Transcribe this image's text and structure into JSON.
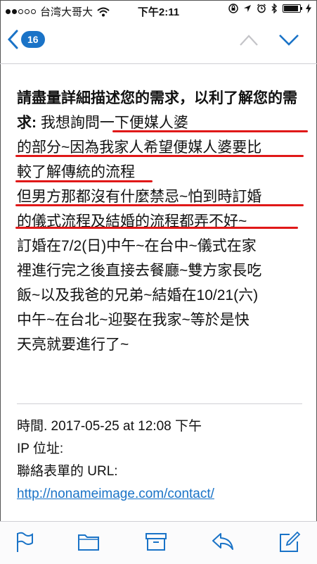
{
  "status": {
    "carrier": "台湾大哥大",
    "time": "下午2:11",
    "battery_level": 0.9
  },
  "nav": {
    "back_count": "16"
  },
  "email": {
    "lead_bold": "請盡量詳細描述您的需求，以利了解您的需求:",
    "lines": [
      "我想詢問一下便媒人婆",
      "的部分~因為我家人希望便媒人婆要比",
      "較了解傳統的流程",
      "但男方那都沒有什麼禁忌~怕到時訂婚",
      "的儀式流程及結婚的流程都弄不好~",
      "訂婚在7/2(日)中午~在台中~儀式在家",
      "裡進行完之後直接去餐廳~雙方家長吃",
      "飯~以及我爸的兄弟~結婚在10/21(六)",
      "中午~在台北~迎娶在我家~等於是快",
      "天亮就要進行了~"
    ]
  },
  "meta": {
    "time_line": "時間. 2017-05-25 at 12:08 下午",
    "ip_line": "IP 位址:",
    "url_label": "聯絡表單的 URL:",
    "url": "http://nonameimage.com/contact/"
  },
  "colors": {
    "accent": "#1a73c7",
    "annotation_red": "#e01818"
  },
  "icons": [
    "flag-icon",
    "folder-icon",
    "archive-icon",
    "reply-icon",
    "compose-icon",
    "chevron-up-icon",
    "chevron-down-icon",
    "back-chevron-icon",
    "wifi-icon",
    "lock-rotation-icon",
    "location-icon",
    "alarm-icon",
    "bluetooth-icon",
    "charging-icon"
  ]
}
